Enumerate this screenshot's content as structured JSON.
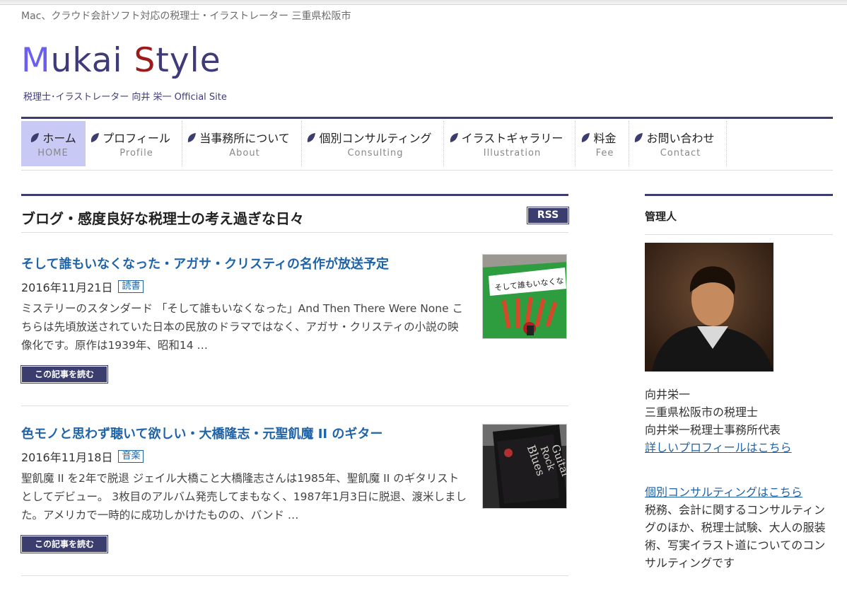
{
  "header": {
    "tagline": "Mac、クラウド会計ソフト対応の税理士・イラストレーター 三重県松阪市",
    "logo_m": "M",
    "logo_1": "ukai ",
    "logo_s": "S",
    "logo_2": "tyle",
    "subtitle": "税理士･イラストレーター 向井 栄一 Official Site"
  },
  "nav": [
    {
      "ja": "ホーム",
      "en": "HOME"
    },
    {
      "ja": "プロフィール",
      "en": "Profile"
    },
    {
      "ja": "当事務所について",
      "en": "About"
    },
    {
      "ja": "個別コンサルティング",
      "en": "Consulting"
    },
    {
      "ja": "イラストギャラリー",
      "en": "Illustration"
    },
    {
      "ja": "料金",
      "en": "Fee"
    },
    {
      "ja": "お問い合わせ",
      "en": "Contact"
    }
  ],
  "blog": {
    "title": "ブログ・感度良好な税理士の考え過ぎな日々",
    "rss": "RSS",
    "read_more": "この記事を読む",
    "posts": [
      {
        "title": "そして誰もいなくなった・アガサ・クリスティの名作が放送予定",
        "date": "2016年11月21日",
        "category": "読書",
        "excerpt": "ミステリーのスタンダード 「そして誰もいなくなった」And Then There Were None こちらは先頃放送されていた日本の民放のドラマではなく、アガサ・クリスティの小説の映像化です。原作は1939年、昭和14 …"
      },
      {
        "title": "色モノと思わず聴いて欲しい・大橋隆志・元聖飢魔 II のギター",
        "date": "2016年11月18日",
        "category": "音楽",
        "excerpt": "聖飢魔 II を2年で脱退 ジェイル大橋こと大橋隆志さんは1985年、聖飢魔 II のギタリストとしてデビュー。 3枚目のアルバム発売してまもなく、1987年1月3日に脱退、渡米しました。アメリカで一時的に成功しかけたものの、バンド …"
      }
    ]
  },
  "sidebar": {
    "title": "管理人",
    "name": "向井栄一",
    "line2": "三重県松阪市の税理士",
    "line3": "向井栄一税理士事務所代表",
    "profile_link": "詳しいプロフィールはこちら",
    "consult_link": "個別コンサルティングはこちら",
    "consult_text": "税務、会計に関するコンサルティングのほか、税理士試験、大人の服装術、写実イラスト道についてのコンサルティングです"
  },
  "colors": {
    "accent": "#3a3d6e",
    "link": "#1f63a8",
    "nav_active": "#c8c9f4"
  }
}
